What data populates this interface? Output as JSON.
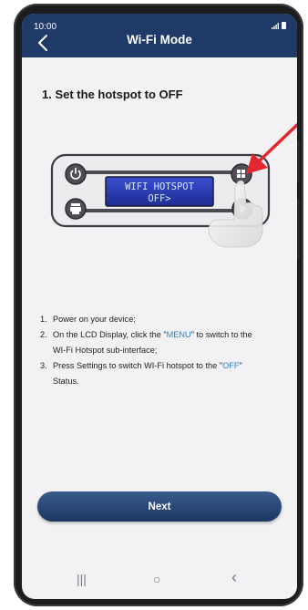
{
  "status_bar": {
    "time": "10:00"
  },
  "header": {
    "title": "Wi-Fi Mode"
  },
  "step": {
    "heading": "1. Set the hotspot to OFF"
  },
  "lcd": {
    "line1": "WIFI HOTSPOT",
    "line2": "OFF>"
  },
  "instructions": [
    {
      "num": "1.",
      "parts": [
        {
          "t": "Power on your device;"
        }
      ]
    },
    {
      "num": "2.",
      "parts": [
        {
          "t": "On the LCD Display, click the \""
        },
        {
          "t": "MENU",
          "k": true
        },
        {
          "t": "\" to switch to the"
        }
      ],
      "cont": [
        {
          "t": "WI-Fi Hotspot sub-interface;"
        }
      ]
    },
    {
      "num": "3.",
      "parts": [
        {
          "t": "Press Settings to switch WI-Fi hotspot to the \""
        },
        {
          "t": "OFF",
          "k": true
        },
        {
          "t": "\""
        }
      ],
      "cont": [
        {
          "t": "Status."
        }
      ]
    }
  ],
  "next_button": {
    "label": "Next"
  },
  "colors": {
    "header": "#1f3a66",
    "accent": "#2a7fd4",
    "button": "#1d3664",
    "pointer": "#e5262e",
    "lcd": "#2d3fb8"
  },
  "icons": {
    "back": "chevron-left-icon",
    "power": "power-icon",
    "settings": "settings-icon",
    "menu": "menu-icon",
    "play": "play-icon",
    "pointer": "red-arrow-icon",
    "hand": "hand-pointer-icon"
  },
  "navbar": {
    "recents": "|||",
    "home": "○",
    "back": "‹"
  }
}
